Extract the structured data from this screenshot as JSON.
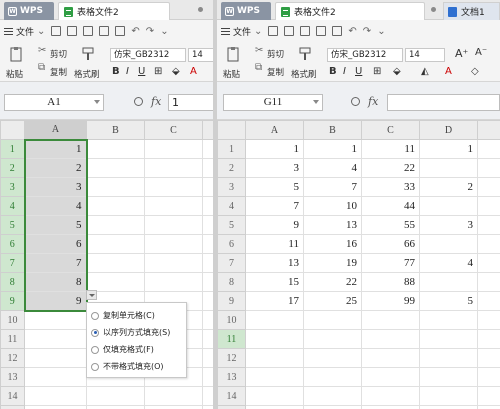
{
  "left": {
    "app_tab": "WPS",
    "doc_tab": "表格文件2",
    "menu_file": "文件",
    "ribbon": {
      "paste": "粘贴",
      "cut": "剪切",
      "copy": "复制",
      "format_painter": "格式刷",
      "font_name": "仿宋_GB2312",
      "font_size": "14"
    },
    "formula": {
      "name_box": "A1",
      "fx_label": "fx",
      "value": "1"
    },
    "columns": [
      "A",
      "B",
      "C"
    ],
    "rows": [
      {
        "n": "1",
        "a": "1"
      },
      {
        "n": "2",
        "a": "2"
      },
      {
        "n": "3",
        "a": "3"
      },
      {
        "n": "4",
        "a": "4"
      },
      {
        "n": "5",
        "a": "5"
      },
      {
        "n": "6",
        "a": "6"
      },
      {
        "n": "7",
        "a": "7"
      },
      {
        "n": "8",
        "a": "8"
      },
      {
        "n": "9",
        "a": "9"
      },
      {
        "n": "10",
        "a": ""
      },
      {
        "n": "11",
        "a": ""
      },
      {
        "n": "12",
        "a": ""
      },
      {
        "n": "13",
        "a": ""
      },
      {
        "n": "14",
        "a": ""
      },
      {
        "n": "15",
        "a": ""
      }
    ],
    "fill_options": [
      {
        "label": "复制单元格(C)",
        "selected": false
      },
      {
        "label": "以序列方式填充(S)",
        "selected": true
      },
      {
        "label": "仅填充格式(F)",
        "selected": false
      },
      {
        "label": "不带格式填充(O)",
        "selected": false
      }
    ]
  },
  "right": {
    "app_tab": "WPS",
    "doc_tab": "表格文件2",
    "doc_tab2": "文档1",
    "menu_file": "文件",
    "ribbon": {
      "paste": "粘贴",
      "cut": "剪切",
      "copy": "复制",
      "format_painter": "格式刷",
      "font_name": "仿宋_GB2312",
      "font_size": "14"
    },
    "formula": {
      "name_box": "G11",
      "fx_label": "fx",
      "value": ""
    },
    "columns": [
      "A",
      "B",
      "C",
      "D"
    ],
    "rows": [
      {
        "n": "1",
        "a": "1",
        "b": "1",
        "c": "11",
        "d": "1"
      },
      {
        "n": "2",
        "a": "3",
        "b": "4",
        "c": "22",
        "d": ""
      },
      {
        "n": "3",
        "a": "5",
        "b": "7",
        "c": "33",
        "d": "2"
      },
      {
        "n": "4",
        "a": "7",
        "b": "10",
        "c": "44",
        "d": ""
      },
      {
        "n": "5",
        "a": "9",
        "b": "13",
        "c": "55",
        "d": "3"
      },
      {
        "n": "6",
        "a": "11",
        "b": "16",
        "c": "66",
        "d": ""
      },
      {
        "n": "7",
        "a": "13",
        "b": "19",
        "c": "77",
        "d": "4"
      },
      {
        "n": "8",
        "a": "15",
        "b": "22",
        "c": "88",
        "d": ""
      },
      {
        "n": "9",
        "a": "17",
        "b": "25",
        "c": "99",
        "d": "5"
      },
      {
        "n": "10",
        "a": "",
        "b": "",
        "c": "",
        "d": ""
      },
      {
        "n": "11",
        "a": "",
        "b": "",
        "c": "",
        "d": ""
      },
      {
        "n": "12",
        "a": "",
        "b": "",
        "c": "",
        "d": ""
      },
      {
        "n": "13",
        "a": "",
        "b": "",
        "c": "",
        "d": ""
      },
      {
        "n": "14",
        "a": "",
        "b": "",
        "c": "",
        "d": ""
      },
      {
        "n": "15",
        "a": "",
        "b": "",
        "c": "",
        "d": ""
      }
    ]
  }
}
